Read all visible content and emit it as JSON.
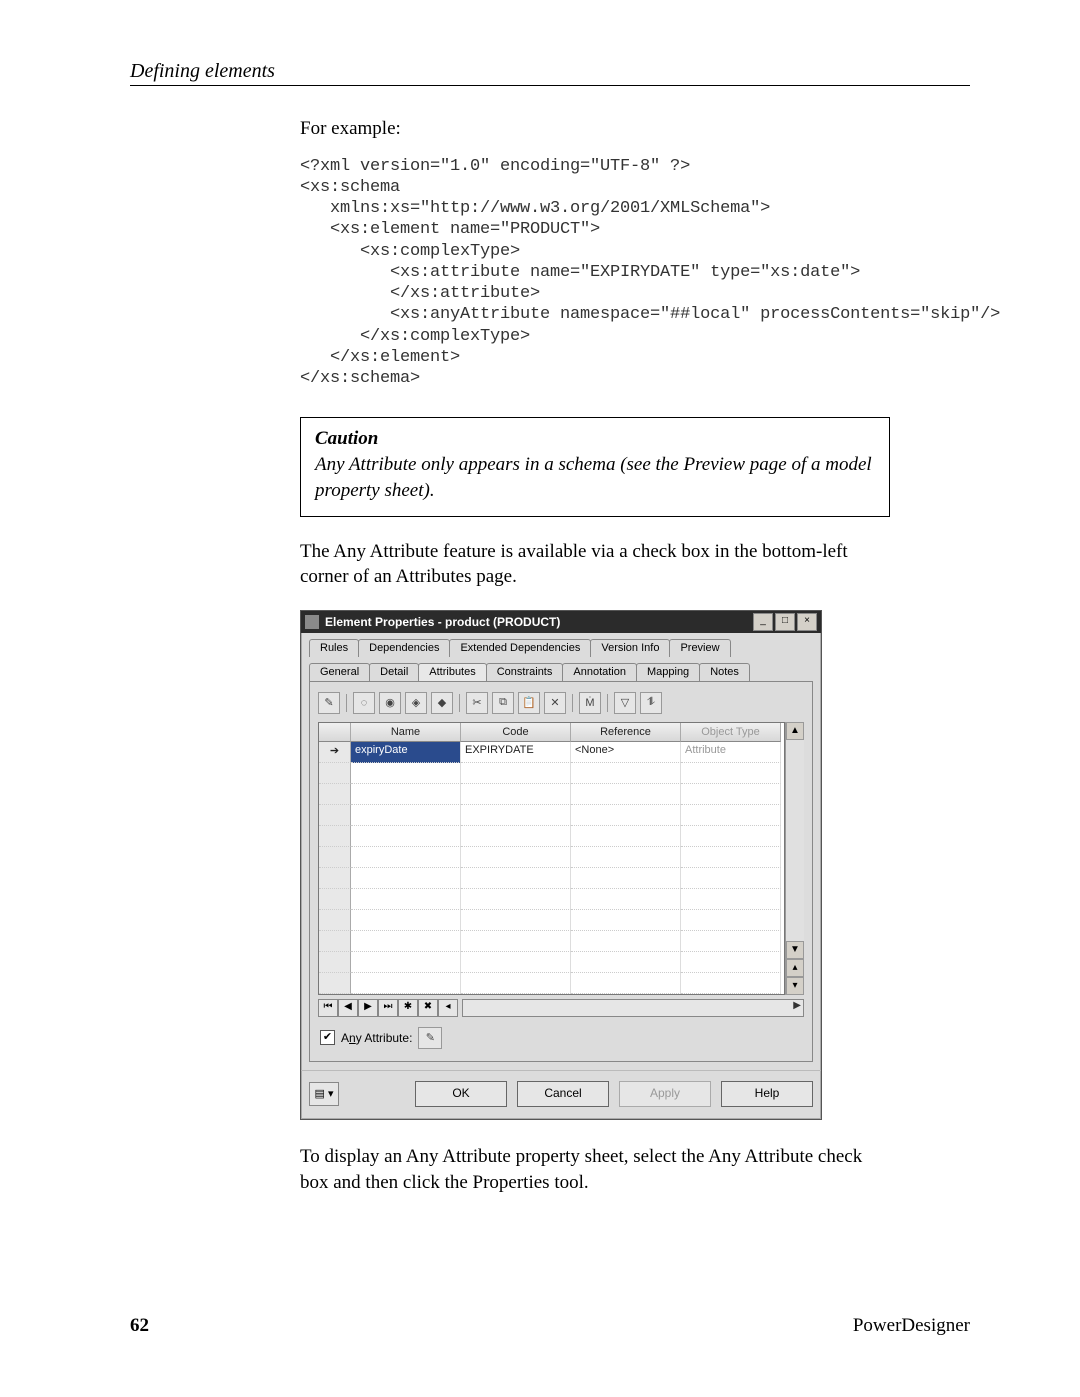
{
  "header": {
    "running_head": "Defining elements"
  },
  "intro": {
    "for_example": "For example:"
  },
  "code": {
    "l1": "<?xml version=\"1.0\" encoding=\"UTF-8\" ?>",
    "l2": "<xs:schema",
    "l3": "   xmlns:xs=\"http://www.w3.org/2001/XMLSchema\">",
    "l4": "   <xs:element name=\"PRODUCT\">",
    "l5": "      <xs:complexType>",
    "l6": "         <xs:attribute name=\"EXPIRYDATE\" type=\"xs:date\">",
    "l7": "         </xs:attribute>",
    "l8": "         <xs:anyAttribute namespace=\"##local\" processContents=\"skip\"/>",
    "l9": "      </xs:complexType>",
    "l10": "   </xs:element>",
    "l11": "</xs:schema>"
  },
  "caution": {
    "title": "Caution",
    "body": "Any Attribute only appears in a schema (see the Preview page of a model property sheet)."
  },
  "para_after_caution": "The Any Attribute feature is available via a check box in the bottom-left corner of an Attributes page.",
  "dialog": {
    "title": "Element Properties - product (PRODUCT)",
    "tabs_row1": [
      "Rules",
      "Dependencies",
      "Extended Dependencies",
      "Version Info",
      "Preview"
    ],
    "tabs_row2": [
      "General",
      "Detail",
      "Attributes",
      "Constraints",
      "Annotation",
      "Mapping",
      "Notes"
    ],
    "active_tab": "Attributes",
    "columns": {
      "c1": "Name",
      "c2": "Code",
      "c3": "Reference",
      "c4": "Object Type"
    },
    "row1": {
      "name": "expiryDate",
      "code": "EXPIRYDATE",
      "reference": "<None>",
      "object_type": "Attribute"
    },
    "any_attribute": {
      "checked": true,
      "label_pre": "A",
      "label_u": "n",
      "label_post": "y Attribute:"
    },
    "buttons": {
      "ok": "OK",
      "cancel": "Cancel",
      "apply": "Apply",
      "help": "Help"
    }
  },
  "para_after_dialog": "To display an Any Attribute property sheet, select the Any Attribute check box and then click the Properties tool.",
  "footer": {
    "page": "62",
    "product": "PowerDesigner"
  }
}
